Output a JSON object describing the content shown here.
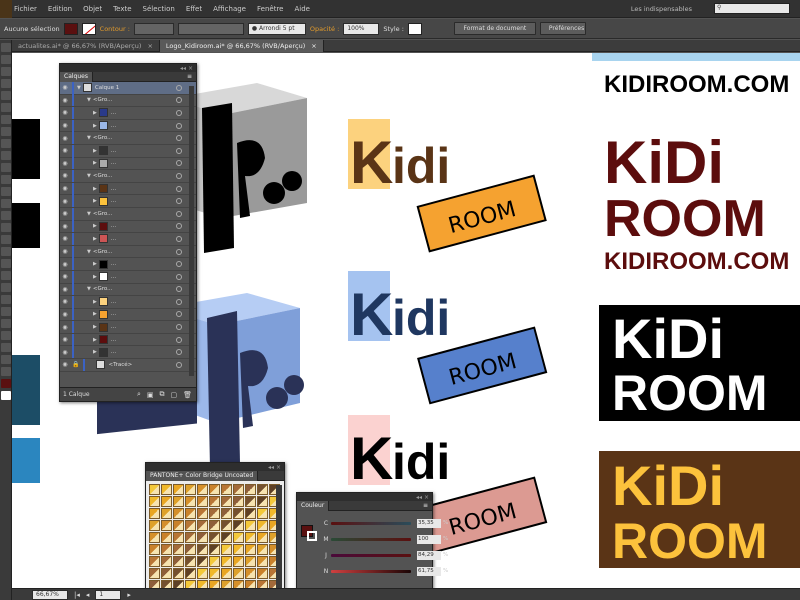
{
  "menubar": {
    "items": [
      "Fichier",
      "Edition",
      "Objet",
      "Texte",
      "Sélection",
      "Effet",
      "Affichage",
      "Fenêtre",
      "Aide"
    ],
    "workspace": "Les indispensables",
    "search_icon": "search-icon"
  },
  "control_bar": {
    "selection_label": "Aucune sélection",
    "fill_color": "#5a1010",
    "stroke_label": "Contour :",
    "brush_label": "Arrondi 5 pt",
    "opacity_label": "Opacité :",
    "opacity_value": "100%",
    "style_label": "Style :",
    "document_format_button": "Format de document",
    "preferences_button": "Préférences"
  },
  "tabs": [
    {
      "label": "actualites.ai* @ 66,67% (RVB/Aperçu)",
      "active": false
    },
    {
      "label": "Logo_Kidiroom.ai* @ 66,67% (RVB/Aperçu)",
      "active": true
    }
  ],
  "layers_panel": {
    "tab": "Calques",
    "layer_name": "Calque 1",
    "group_label": "<Gro...",
    "ellipsis": "...",
    "trace_label": "<Tracé>",
    "footer": "1 Calque"
  },
  "swatch_panel": {
    "tab": "PANTONE+ Color Bridge Uncoated"
  },
  "color_panel": {
    "tab": "Couleur",
    "sliders": [
      {
        "label": "C",
        "value": "35,35",
        "percent": 35.35
      },
      {
        "label": "M",
        "value": "100",
        "percent": 100
      },
      {
        "label": "J",
        "value": "84,29",
        "percent": 84.29
      },
      {
        "label": "N",
        "value": "61,75",
        "percent": 61.75
      }
    ],
    "percent_sign": "%"
  },
  "status_bar": {
    "zoom": "66,67%",
    "page": "1"
  },
  "artboard": {
    "logo_kidi": "Kidi",
    "logo_room": "ROOM",
    "logo_k": "K",
    "logo_idi": "idi",
    "wordmark": "KIDIROOM.COM",
    "block_kidi": "KiDi",
    "block_room": "ROOM",
    "colors": {
      "brown": "#5a3416",
      "yellow_square": "#fcd27e",
      "orange_tag": "#f5a230",
      "navy": "#1f3760",
      "light_blue_square": "#a5c3f0",
      "blue_tag": "#5680cc",
      "pink_square": "#fbd2d0",
      "pink_tag": "#dc9a92",
      "maroon": "#5c0d0d",
      "gold": "#fcc23c"
    }
  }
}
